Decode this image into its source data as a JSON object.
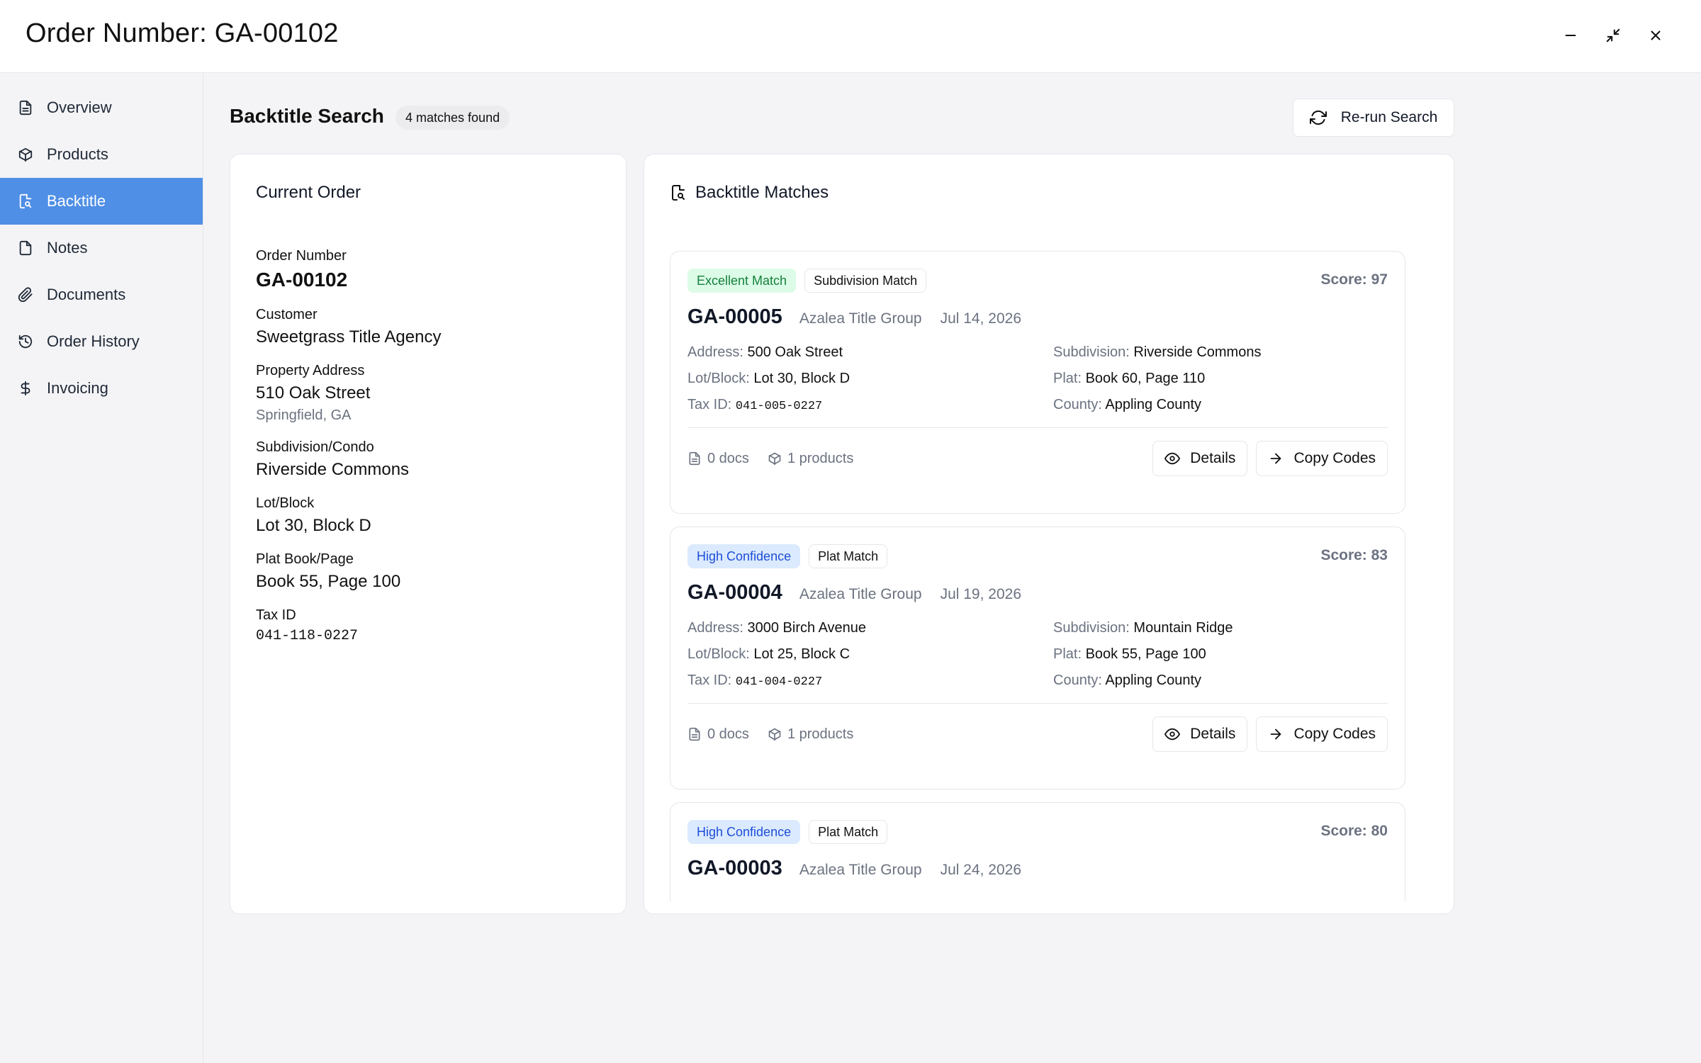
{
  "window": {
    "title": "Order Number: GA-00102",
    "minimize_icon": "minimize-icon",
    "restore_icon": "minimize-arrows-icon",
    "close_icon": "close-icon"
  },
  "sidebar": {
    "items": [
      {
        "label": "Overview",
        "icon": "document-icon",
        "active": false
      },
      {
        "label": "Products",
        "icon": "package-icon",
        "active": false
      },
      {
        "label": "Backtitle",
        "icon": "file-search-icon",
        "active": true
      },
      {
        "label": "Notes",
        "icon": "note-icon",
        "active": false
      },
      {
        "label": "Documents",
        "icon": "paperclip-icon",
        "active": false
      },
      {
        "label": "Order History",
        "icon": "history-icon",
        "active": false
      },
      {
        "label": "Invoicing",
        "icon": "dollar-icon",
        "active": false
      }
    ]
  },
  "section": {
    "title": "Backtitle Search",
    "matches_badge": "4 matches found",
    "rerun_label": "Re-run Search"
  },
  "current_order": {
    "title": "Current Order",
    "order_number_label": "Order Number",
    "order_number": "GA-00102",
    "customer_label": "Customer",
    "customer": "Sweetgrass Title Agency",
    "address_label": "Property Address",
    "address": "510 Oak Street",
    "city": "Springfield, GA",
    "subdivision_label": "Subdivision/Condo",
    "subdivision": "Riverside Commons",
    "lot_label": "Lot/Block",
    "lot": "Lot 30, Block D",
    "plat_label": "Plat Book/Page",
    "plat": "Book 55, Page 100",
    "tax_label": "Tax ID",
    "tax": "041-118-0227"
  },
  "matches": {
    "title": "Backtitle Matches",
    "labels": {
      "address": "Address:",
      "subdivision": "Subdivision:",
      "lot": "Lot/Block:",
      "plat": "Plat:",
      "tax": "Tax ID:",
      "county": "County:",
      "details": "Details",
      "copy": "Copy Codes"
    },
    "items": [
      {
        "tag1": "Excellent Match",
        "tag1_color": "#dcfce7",
        "tag2": "Subdivision Match",
        "score": "Score: 97",
        "order_id": "GA-00005",
        "agency": "Azalea Title Group",
        "date": "Jul 14, 2026",
        "address": "500 Oak Street",
        "subdivision": "Riverside Commons",
        "lot": "Lot 30, Block D",
        "plat": "Book 60, Page 110",
        "tax": "041-005-0227",
        "county": "Appling County",
        "docs": "0 docs",
        "products": "1 products"
      },
      {
        "tag1": "High Confidence",
        "tag1_color": "#dbeafe",
        "tag2": "Plat Match",
        "score": "Score: 83",
        "order_id": "GA-00004",
        "agency": "Azalea Title Group",
        "date": "Jul 19, 2026",
        "address": "3000 Birch Avenue",
        "subdivision": "Mountain Ridge",
        "lot": "Lot 25, Block C",
        "plat": "Book 55, Page 100",
        "tax": "041-004-0227",
        "county": "Appling County",
        "docs": "0 docs",
        "products": "1 products"
      },
      {
        "tag1": "High Confidence",
        "tag1_color": "#dbeafe",
        "tag2": "Plat Match",
        "score": "Score: 80",
        "order_id": "GA-00003",
        "agency": "Azalea Title Group",
        "date": "Jul 24, 2026"
      }
    ]
  }
}
